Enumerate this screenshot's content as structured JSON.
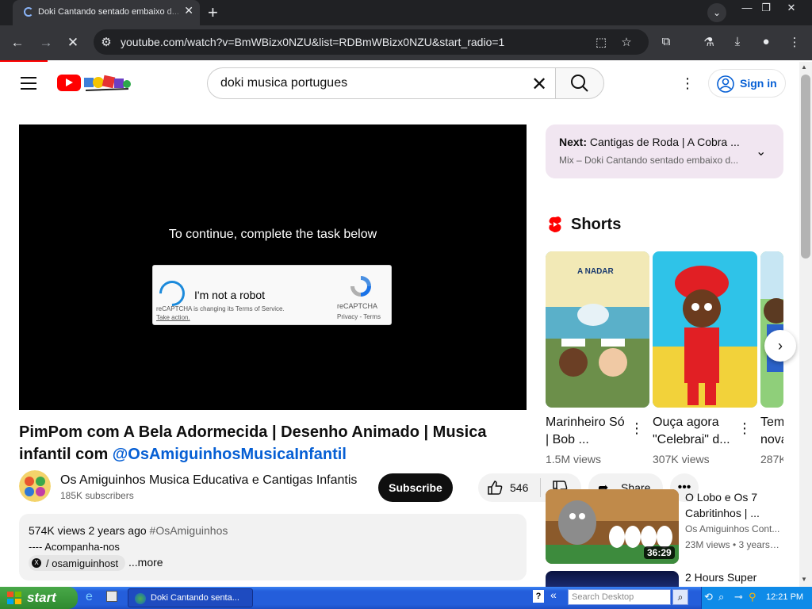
{
  "browser": {
    "tab_title": "Doki Cantando sentado embaixo d...",
    "url": "youtube.com/watch?v=BmWBizx0NZU&list=RDBmWBizx0NZU&start_radio=1"
  },
  "header": {
    "search_query": "doki musica portugues",
    "sign_in": "Sign in"
  },
  "player": {
    "continue_text": "To continue, complete the task below",
    "recaptcha": {
      "checkbox_label": "I'm not a robot",
      "note": "reCAPTCHA is changing its Terms of Service.",
      "take_action": "Take action.",
      "brand": "reCAPTCHA",
      "privacy_terms": "Privacy - Terms"
    }
  },
  "video": {
    "title": "PimPom com A Bela Adormecida | Desenho Animado | Musica infantil com ",
    "title_link": "@OsAmiguinhosMusicaInfantil",
    "channel_name": "Os Amiguinhos Musica Educativa e Cantigas Infantis",
    "subscribers": "185K subscribers",
    "subscribe_label": "Subscribe",
    "likes": "546",
    "share_label": "Share",
    "views_date": "574K views  2 years ago",
    "hashtag": "#OsAmiguinhos",
    "desc_line": "---- Acompanha-nos",
    "x_handle": "/ osamiguinhost",
    "more": "...more"
  },
  "sidebar": {
    "next_prefix": "Next:",
    "next_title": "Cantigas de Roda | A Cobra ...",
    "mix_line": "Mix – Doki Cantando sentado embaixo d...",
    "shorts_heading": "Shorts",
    "shorts": [
      {
        "title": "Marinheiro Só | Bob ...",
        "views": "1.5M views",
        "thumb_text": "A NADAR"
      },
      {
        "title": "Ouça agora \"Celebrai\" d...",
        "views": "307K views"
      },
      {
        "title": "Tem nova",
        "views": "287K"
      }
    ],
    "videos": [
      {
        "title": "O Lobo e Os 7 Cabritinhos | ...",
        "channel": "Os Amiguinhos Cont...",
        "meta": "23M views • 3 years ...",
        "duration": "36:29"
      },
      {
        "title": "2 Hours Super"
      }
    ]
  },
  "taskbar": {
    "start": "start",
    "task_item": "Doki Cantando senta...",
    "search_placeholder": "Search Desktop",
    "clock": "12:21 PM"
  }
}
